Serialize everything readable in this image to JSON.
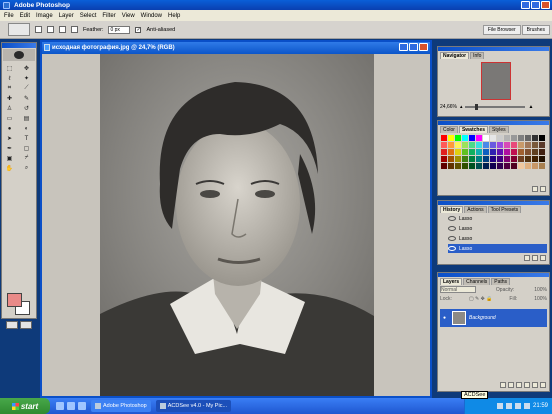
{
  "titlebar": {
    "title": "Adobe Photoshop"
  },
  "menu": [
    "File",
    "Edit",
    "Image",
    "Layer",
    "Select",
    "Filter",
    "View",
    "Window",
    "Help"
  ],
  "options": {
    "feather_label": "Feather:",
    "feather_value": "0 px",
    "antialiased_label": "Anti-aliased",
    "antialiased_checked": "✓"
  },
  "palette_well": {
    "tabs": [
      "File Browser",
      "Brushes"
    ]
  },
  "document": {
    "title": "исходная фотография.jpg @ 24,7% (RGB)"
  },
  "navigator": {
    "tabs": [
      "Navigator",
      "Info"
    ],
    "zoom": "24,66%"
  },
  "swatches": {
    "tabs": [
      "Color",
      "Swatches",
      "Styles"
    ],
    "colors": [
      "#ff0000",
      "#ffff00",
      "#00ff00",
      "#00ffff",
      "#0000ff",
      "#ff00ff",
      "#ffffff",
      "#e6e6e6",
      "#cccccc",
      "#b3b3b3",
      "#999999",
      "#808080",
      "#666666",
      "#333333",
      "#000000",
      "#ff5a5a",
      "#ff9a3a",
      "#fff35a",
      "#9be35a",
      "#4adb8a",
      "#3ae0e0",
      "#4a8ae8",
      "#6a5ae0",
      "#9a4ae0",
      "#d84ab8",
      "#e84a7a",
      "#c89a6a",
      "#a0785a",
      "#7a5a3a",
      "#5a3a2a",
      "#e02020",
      "#e07010",
      "#e0d010",
      "#60c020",
      "#10b060",
      "#10b0b0",
      "#1060c0",
      "#3020b0",
      "#6010b0",
      "#b010a0",
      "#c01050",
      "#a06030",
      "#805030",
      "#604020",
      "#402010",
      "#a00000",
      "#a05000",
      "#a09000",
      "#408010",
      "#008040",
      "#008080",
      "#004080",
      "#200080",
      "#400080",
      "#800070",
      "#800030",
      "#704020",
      "#503010",
      "#402000",
      "#201000",
      "#600000",
      "#603000",
      "#605000",
      "#305000",
      "#005020",
      "#005050",
      "#002050",
      "#100050",
      "#300050",
      "#500040",
      "#500020",
      "#f0c8a0",
      "#e0b080",
      "#c89868",
      "#a88050"
    ]
  },
  "history": {
    "tabs": [
      "History",
      "Actions",
      "Tool Presets"
    ],
    "items": [
      {
        "label": "Lasso",
        "selected": false
      },
      {
        "label": "Lasso",
        "selected": false
      },
      {
        "label": "Lasso",
        "selected": false
      },
      {
        "label": "Lasso",
        "selected": true
      }
    ]
  },
  "layers": {
    "tabs": [
      "Layers",
      "Channels",
      "Paths"
    ],
    "blend_mode": "Normal",
    "opacity_label": "Opacity:",
    "opacity_value": "100%",
    "lock_label": "Lock:",
    "fill_label": "Fill:",
    "fill_value": "100%",
    "layer_name": "Background"
  },
  "taskbar": {
    "start": "start",
    "tasks": [
      {
        "label": "Adobe Photoshop",
        "active": false
      },
      {
        "label": "ACDSee v4.0 - My Pic...",
        "active": true
      }
    ],
    "clock": "21:59",
    "tooltip": "ACDSee"
  }
}
